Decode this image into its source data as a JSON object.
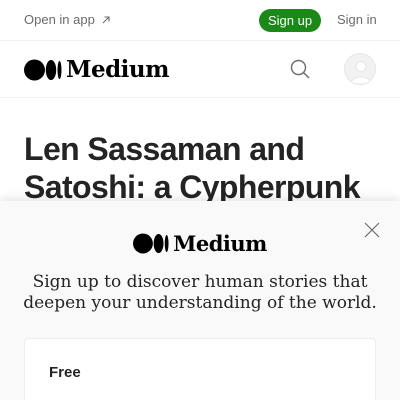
{
  "topbar": {
    "open_app_label": "Open in app",
    "open_app_icon": "arrow-up-right-icon",
    "signup_label": "Sign up",
    "signin_label": "Sign in"
  },
  "navbar": {
    "logo_text": "Medium",
    "logo_icon": "medium-circles-icon",
    "search_icon": "search-icon",
    "avatar_icon": "user-icon"
  },
  "article": {
    "title": "Len Sassaman and Satoshi: a Cypherpunk"
  },
  "modal": {
    "close_icon": "close-icon",
    "logo_text": "Medium",
    "heading": "Sign up to discover human stories that deepen your understanding of the world.",
    "plans": [
      {
        "name": "Free"
      }
    ]
  },
  "colors": {
    "accent_green": "#1a8917",
    "text_primary": "#242424",
    "text_secondary": "#6b6b6b",
    "modal_bg": "#f9f9f9"
  }
}
